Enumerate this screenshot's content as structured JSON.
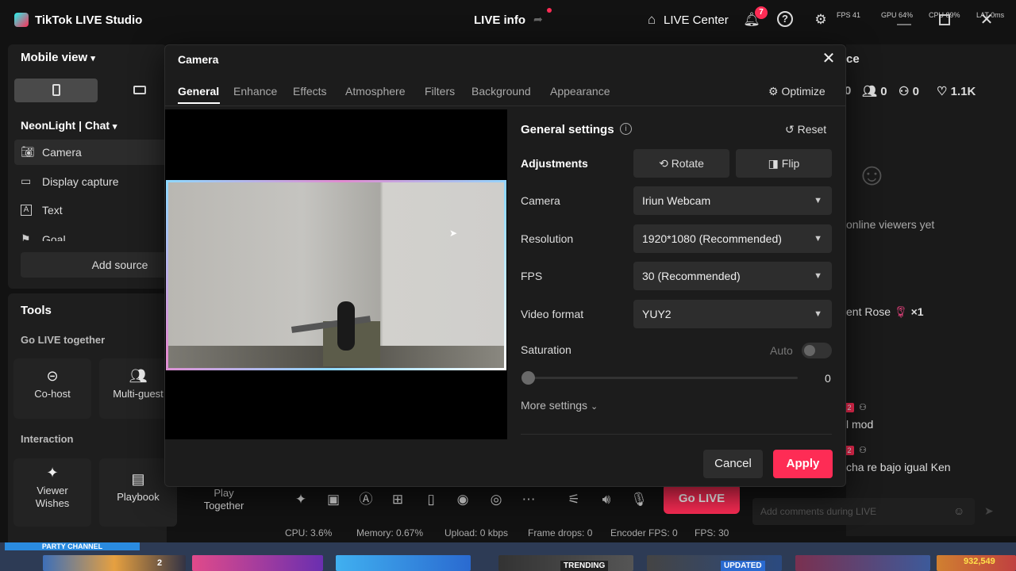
{
  "app": {
    "title": "TikTok LIVE Studio",
    "live_info": "LIVE info",
    "live_center": "LIVE Center",
    "notification_count": "7",
    "stats": {
      "fps": "FPS 41",
      "gpu": "GPU 64%",
      "cpu": "CPU 89%",
      "lat": "LAT 0ms"
    }
  },
  "left_panel": {
    "view_title": "Mobile view",
    "scene_name": "NeonLight | Chat",
    "sources": [
      {
        "label": "Camera",
        "icon": "camera-icon"
      },
      {
        "label": "Display capture",
        "icon": "monitor-icon"
      },
      {
        "label": "Text",
        "icon": "text-icon"
      },
      {
        "label": "Goal",
        "icon": "goal-icon"
      }
    ],
    "add_source": "Add source"
  },
  "tools": {
    "title": "Tools",
    "group1": "Go LIVE together",
    "cohost": "Co-host",
    "multiguest": "Multi-guest",
    "group2": "Interaction",
    "viewer_wishes": "Viewer Wishes",
    "playbook": "Playbook",
    "play_together": "Play Together"
  },
  "right_panel": {
    "heading_fragment": "ce",
    "stat1": "0",
    "stat2": "0",
    "stat3": "0",
    "likes": "1.1K",
    "no_viewers": "online viewers yet",
    "gift_label": "ent Rose",
    "gift_count": "×1",
    "badge1": "2",
    "comment1": "l mod",
    "badge2": "2",
    "comment2": "cha re bajo igual Ken",
    "comment_placeholder": "Add comments during LIVE"
  },
  "modal": {
    "title": "Camera",
    "tabs": [
      "General",
      "Enhance",
      "Effects",
      "Atmosphere",
      "Filters",
      "Background",
      "Appearance"
    ],
    "optimize": "Optimize",
    "general_settings": "General settings",
    "reset": "Reset",
    "adjustments": "Adjustments",
    "rotate": "Rotate",
    "flip": "Flip",
    "camera_label": "Camera",
    "camera_value": "Iriun Webcam",
    "resolution_label": "Resolution",
    "resolution_value": "1920*1080 (Recommended)",
    "fps_label": "FPS",
    "fps_value": "30 (Recommended)",
    "video_format_label": "Video format",
    "video_format_value": "YUY2",
    "saturation_label": "Saturation",
    "auto_label": "Auto",
    "saturation_value": "0",
    "more_settings": "More settings",
    "cancel": "Cancel",
    "apply": "Apply"
  },
  "bottom": {
    "go_live": "Go LIVE",
    "cpu": "CPU: 3.6%",
    "memory": "Memory: 0.67%",
    "upload": "Upload: 0 kbps",
    "frame_drops": "Frame drops: 0",
    "encoder_fps": "Encoder FPS: 0",
    "fps": "FPS: 30"
  },
  "taskbar": {
    "party_channel": "PARTY CHANNEL",
    "trending": "TRENDING",
    "updated": "UPDATED",
    "counter": "932,549",
    "badge": "2"
  },
  "colors": {
    "accent": "#fe2c55",
    "background": "#121212",
    "panel": "#1e1e1e"
  }
}
